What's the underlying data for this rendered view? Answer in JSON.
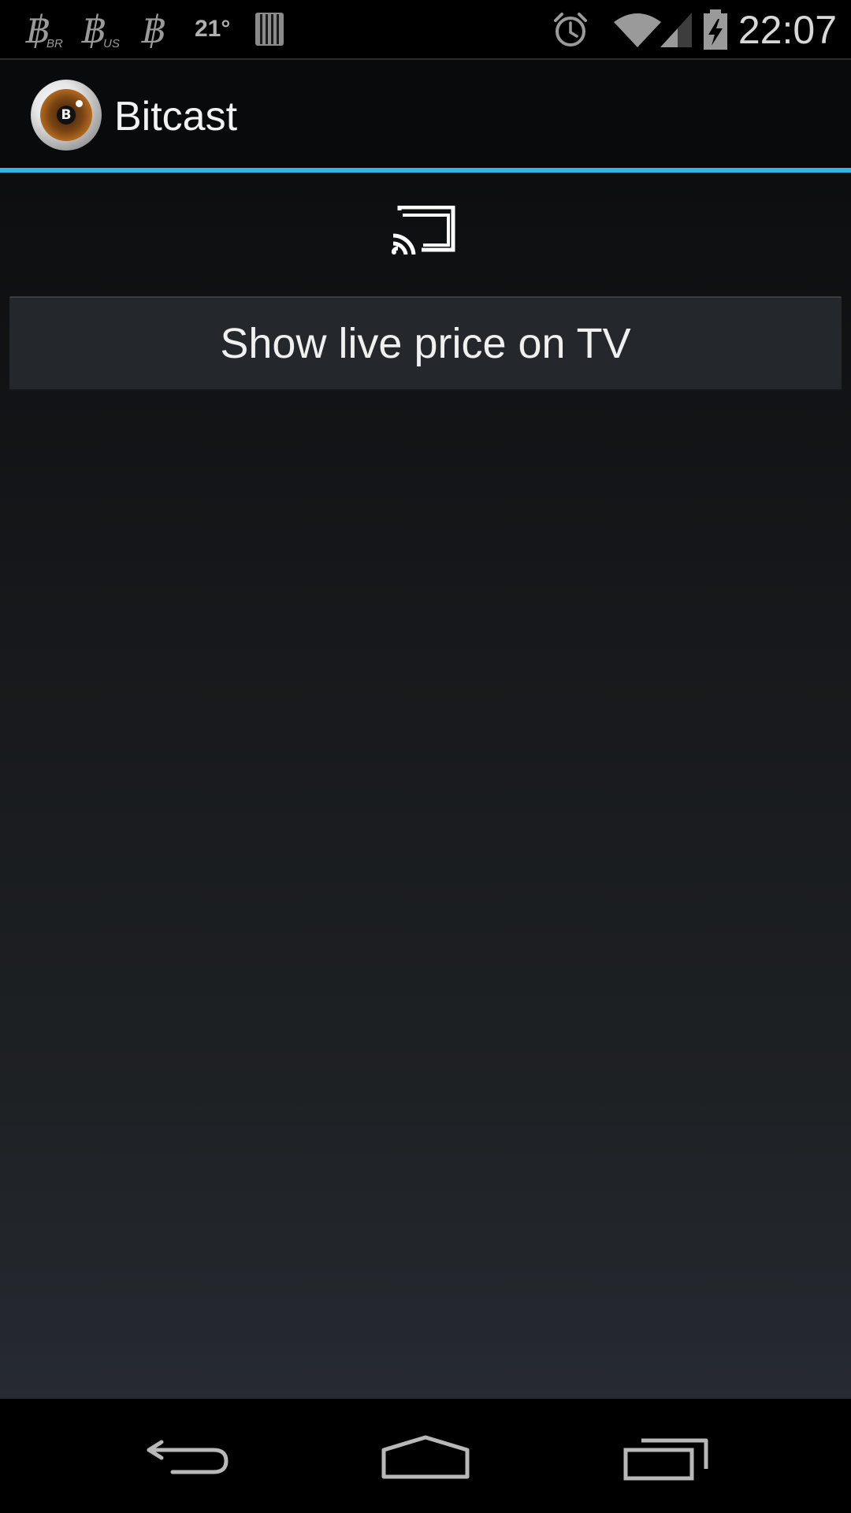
{
  "status_bar": {
    "notifications": [
      {
        "icon": "bitcoin-br-icon",
        "subscript": "BR"
      },
      {
        "icon": "bitcoin-us-icon",
        "subscript": "US"
      },
      {
        "icon": "bitcoin-icon",
        "subscript": ""
      }
    ],
    "temperature": "21°",
    "time": "22:07",
    "system_icons": [
      "alarm-icon",
      "wifi-icon",
      "signal-icon",
      "battery-charging-icon"
    ],
    "text_color": "#9a9a9a"
  },
  "action_bar": {
    "title": "Bitcast",
    "logo_icon": "bitcast-logo",
    "logo_letter": "B",
    "accent_color": "#33b5e5"
  },
  "content": {
    "cast_icon": "cast-icon",
    "button_label": "Show live price on TV"
  },
  "nav_bar": {
    "buttons": [
      "back-icon",
      "home-icon",
      "recent-apps-icon"
    ]
  }
}
